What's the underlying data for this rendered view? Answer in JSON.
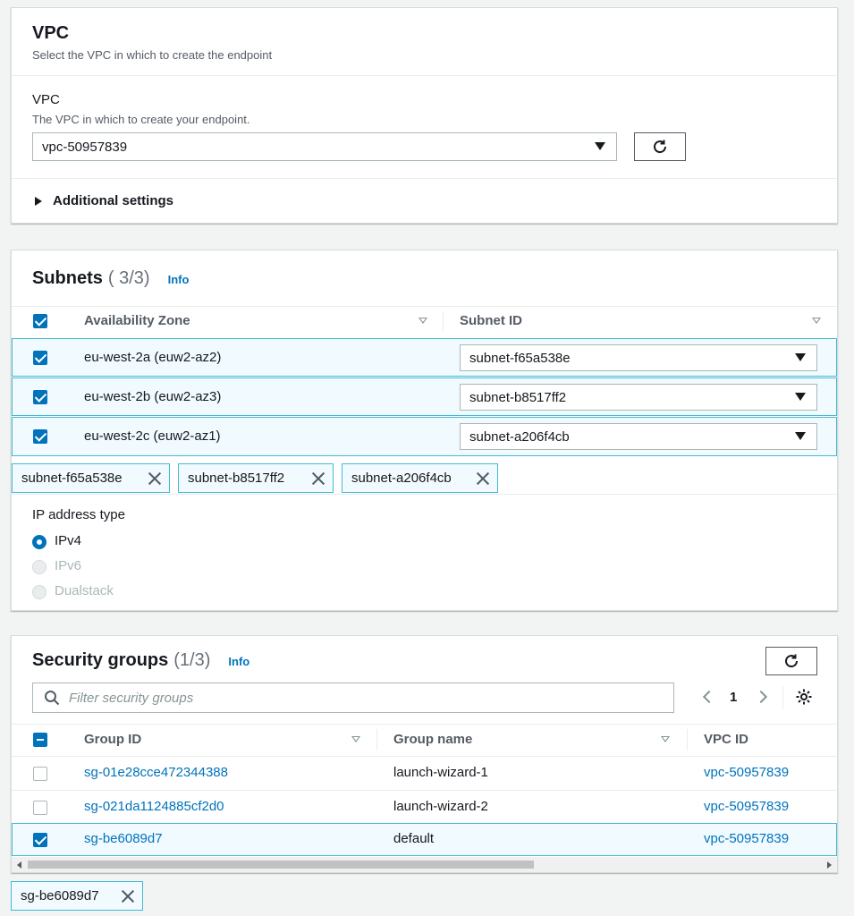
{
  "vpc_panel": {
    "title": "VPC",
    "description": "Select the VPC in which to create the endpoint",
    "field_label": "VPC",
    "field_description": "The VPC in which to create your endpoint.",
    "selected_vpc": "vpc-50957839",
    "additional_settings": "Additional settings"
  },
  "subnets_panel": {
    "title": "Subnets",
    "count": "( 3/3)",
    "info": "Info",
    "columns": [
      "Availability Zone",
      "Subnet ID"
    ],
    "rows": [
      {
        "az": "eu-west-2a (euw2-az2)",
        "subnet": "subnet-f65a538e"
      },
      {
        "az": "eu-west-2b (euw2-az3)",
        "subnet": "subnet-b8517ff2"
      },
      {
        "az": "eu-west-2c (euw2-az1)",
        "subnet": "subnet-a206f4cb"
      }
    ],
    "tokens": [
      "subnet-f65a538e",
      "subnet-b8517ff2",
      "subnet-a206f4cb"
    ],
    "ip_type_label": "IP address type",
    "ip_options": [
      "IPv4",
      "IPv6",
      "Dualstack"
    ],
    "ip_selected": "IPv4"
  },
  "sg_panel": {
    "title": "Security groups",
    "count": "(1/3)",
    "info": "Info",
    "search_placeholder": "Filter security groups",
    "page": "1",
    "columns": [
      "Group ID",
      "Group name",
      "VPC ID"
    ],
    "rows": [
      {
        "id": "sg-01e28cce472344388",
        "name": "launch-wizard-1",
        "vpc": "vpc-50957839",
        "selected": false
      },
      {
        "id": "sg-021da1124885cf2d0",
        "name": "launch-wizard-2",
        "vpc": "vpc-50957839",
        "selected": false
      },
      {
        "id": "sg-be6089d7",
        "name": "default",
        "vpc": "vpc-50957839",
        "selected": true
      }
    ],
    "tokens": [
      "sg-be6089d7"
    ]
  },
  "colors": {
    "accent": "#0073bb",
    "selected_border": "#44b9d6",
    "selected_bg": "#f1faff"
  },
  "icons": [
    "refresh-icon",
    "caret-down-icon",
    "caret-right-icon",
    "search-icon",
    "gear-icon",
    "close-icon",
    "chevron-left-icon",
    "chevron-right-icon"
  ]
}
